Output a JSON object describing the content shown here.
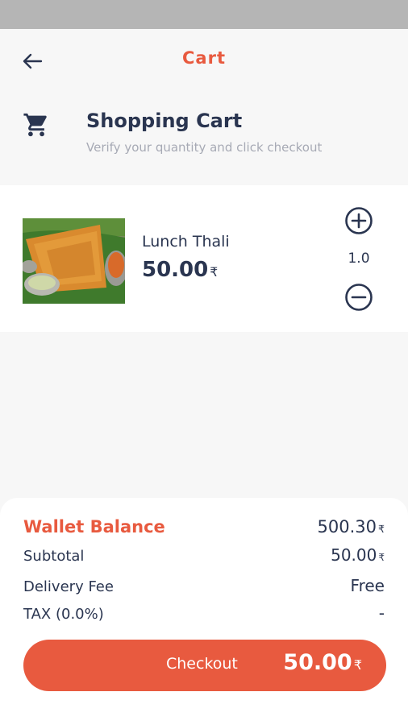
{
  "app_bar": {
    "title": "Cart",
    "back_icon": "arrow-left-icon"
  },
  "header": {
    "icon": "shopping-cart-icon",
    "title": "Shopping Cart",
    "subtitle": "Verify your quantity and click checkout"
  },
  "currency_symbol": "₹",
  "cart_items": [
    {
      "name": "Lunch Thali",
      "price": "50.00",
      "quantity": "1.0"
    }
  ],
  "summary": {
    "wallet_label": "Wallet Balance",
    "wallet_value": "500.30",
    "subtotal_label": "Subtotal",
    "subtotal_value": "50.00",
    "delivery_label": "Delivery Fee",
    "delivery_value": "Free",
    "tax_label": "TAX (0.0%)",
    "tax_value": "-"
  },
  "checkout": {
    "label": "Checkout",
    "amount": "50.00"
  },
  "colors": {
    "accent": "#e85a3f",
    "text": "#2a3550",
    "muted": "#a7aab5",
    "background": "#f7f7f7"
  }
}
